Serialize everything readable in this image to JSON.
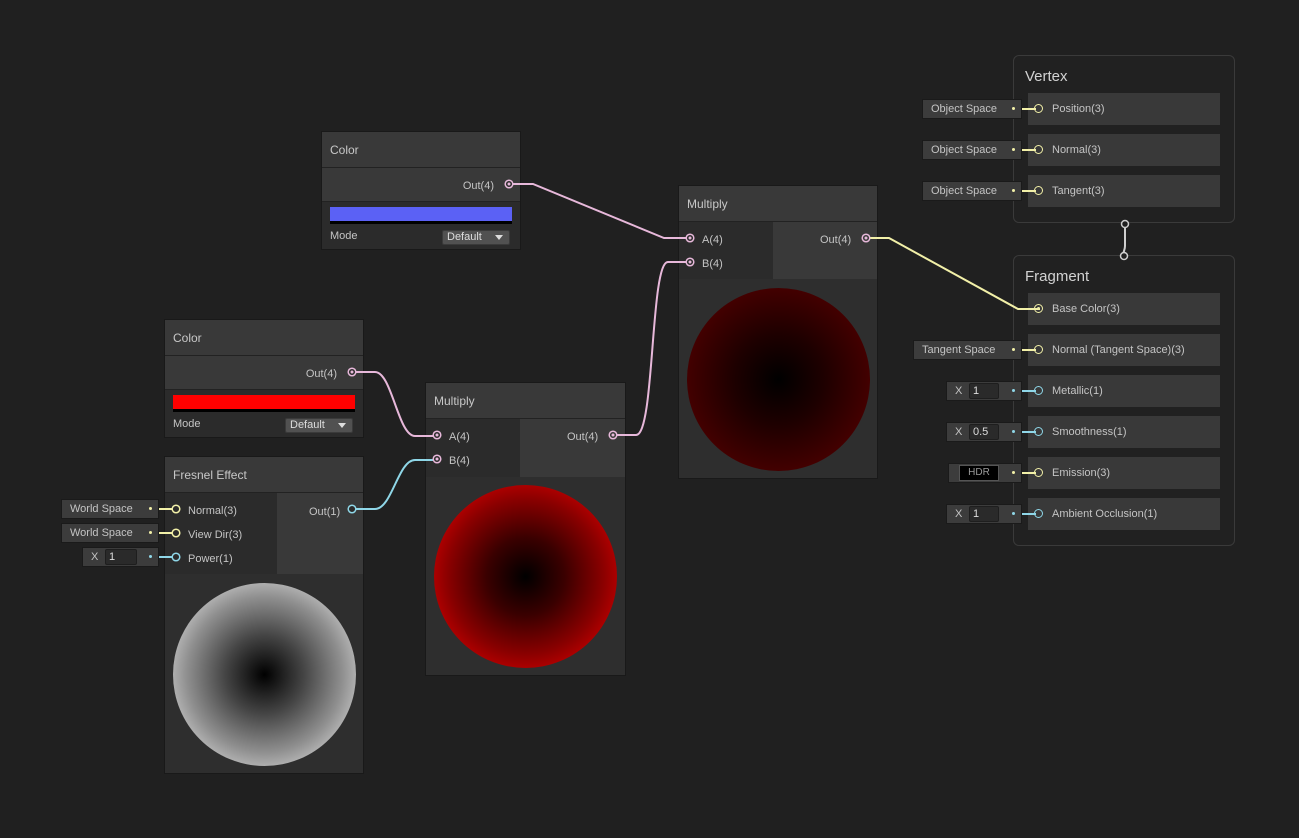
{
  "colors": {
    "background": "#202020",
    "node_body": "#2b2b2b",
    "node_header": "#393939",
    "port_color4": "#e7b8da",
    "port_vector3": "#f2f0a8",
    "port_float": "#8fd7e8",
    "color_node_1_value": "#5b61f5",
    "color_node_2_value": "#ff0000"
  },
  "color_node_1": {
    "title": "Color",
    "output": "Out(4)",
    "swatch": "#5b61f5",
    "mode_label": "Mode",
    "mode_value": "Default"
  },
  "color_node_2": {
    "title": "Color",
    "output": "Out(4)",
    "swatch": "#ff0000",
    "mode_label": "Mode",
    "mode_value": "Default"
  },
  "fresnel_node": {
    "title": "Fresnel Effect",
    "inputs": [
      "Normal(3)",
      "View Dir(3)",
      "Power(1)"
    ],
    "output": "Out(1)",
    "normal_space": "World Space",
    "viewdir_space": "World Space",
    "power_axis": "X",
    "power_value": "1"
  },
  "multiply_node_1": {
    "title": "Multiply",
    "inputs": [
      "A(4)",
      "B(4)"
    ],
    "output": "Out(4)"
  },
  "multiply_node_2": {
    "title": "Multiply",
    "inputs": [
      "A(4)",
      "B(4)"
    ],
    "output": "Out(4)"
  },
  "vertex_stack": {
    "title": "Vertex",
    "slots": [
      {
        "label": "Position(3)",
        "input": "Object Space"
      },
      {
        "label": "Normal(3)",
        "input": "Object Space"
      },
      {
        "label": "Tangent(3)",
        "input": "Object Space"
      }
    ]
  },
  "fragment_stack": {
    "title": "Fragment",
    "base_color": "Base Color(3)",
    "normal": "Normal (Tangent Space)(3)",
    "normal_space": "Tangent Space",
    "metallic": "Metallic(1)",
    "metallic_axis": "X",
    "metallic_value": "1",
    "smoothness": "Smoothness(1)",
    "smoothness_axis": "X",
    "smoothness_value": "0.5",
    "emission": "Emission(3)",
    "emission_badge": "HDR",
    "occlusion": "Ambient Occlusion(1)",
    "occlusion_axis": "X",
    "occlusion_value": "1"
  }
}
